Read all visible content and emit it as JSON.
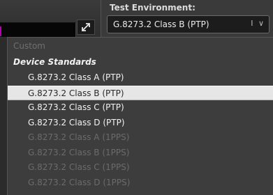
{
  "environment": {
    "label": "Test Environment:",
    "selected": "G.8273.2 Class B (PTP)",
    "arrow": "I ∨"
  },
  "expand": {
    "icon": "expand-arrows-icon"
  },
  "dropdown": {
    "groups": {
      "custom": "Custom",
      "device_standards": "Device Standards"
    },
    "items": [
      {
        "label": "G.8273.2 Class A (PTP)",
        "state": "enabled"
      },
      {
        "label": "G.8273.2 Class B (PTP)",
        "state": "selected"
      },
      {
        "label": "G.8273.2 Class C (PTP)",
        "state": "enabled"
      },
      {
        "label": "G.8273.2 Class D (PTP)",
        "state": "enabled"
      },
      {
        "label": "G.8273.2 Class A (1PPS)",
        "state": "disabled"
      },
      {
        "label": "G.8273.2 Class B (1PPS)",
        "state": "disabled"
      },
      {
        "label": "G.8273.2 Class C (1PPS)",
        "state": "disabled"
      },
      {
        "label": "G.8273.2 Class D (1PPS)",
        "state": "disabled"
      }
    ]
  },
  "colors": {
    "selected_bg": "#e6e6e6",
    "list_bg": "#3d3d3d",
    "disabled_text": "#6b6b6b",
    "accent_mark": "#b000b0"
  }
}
